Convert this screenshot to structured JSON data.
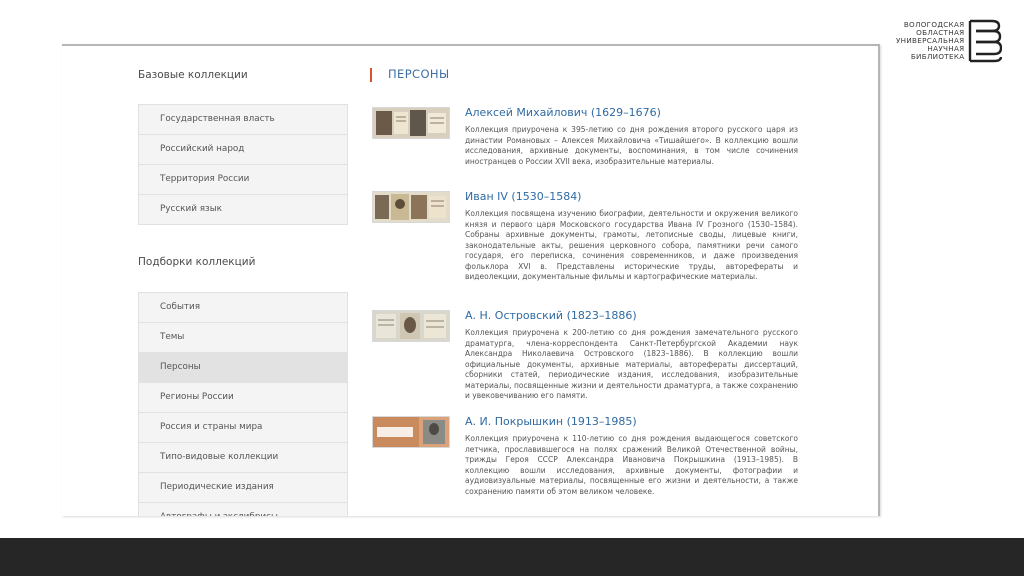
{
  "logo": {
    "lines": [
      "ВОЛОГОДСКАЯ",
      "ОБЛАСТНАЯ",
      "УНИВЕРСАЛЬНАЯ",
      "НАУЧНАЯ",
      "БИБЛИОТЕКА"
    ]
  },
  "sidebar": {
    "base_heading": "Базовые коллекции",
    "base_items": [
      "Государственная власть",
      "Российский народ",
      "Территория России",
      "Русский язык"
    ],
    "selection_heading": "Подборки коллекций",
    "selection_items": [
      "События",
      "Темы",
      "Персоны",
      "Регионы России",
      "Россия и страны мира",
      "Типо-видовые коллекции",
      "Периодические издания",
      "Автографы и экслибрисы"
    ],
    "active_item": "Персоны"
  },
  "main": {
    "section_title": "ПЕРСОНЫ",
    "entries": [
      {
        "title": "Алексей Михайлович (1629–1676)",
        "description": "Коллекция приурочена к 395-летию со дня рождения второго русского царя из династии Романовых – Алексея Михайловича «Тишайшего». В коллекцию вошли исследования, архивные документы, воспоминания, в том числе сочинения иностранцев о России XVII века, изобразительные материалы."
      },
      {
        "title": "Иван IV (1530–1584)",
        "description": "Коллекция посвящена изучению биографии, деятельности и окружения великого князя и первого царя Московского государства Ивана IV Грозного (1530–1584). Собраны архивные документы, грамоты, летописные своды, лицевые книги, законодательные акты, решения церковного собора, памятники речи самого государя, его переписка, сочинения современников, и даже произведения фольклора XVI в. Представлены исторические труды, авторефераты и видеолекции, документальные фильмы и картографические материалы."
      },
      {
        "title": "А. Н. Островский (1823–1886)",
        "description": "Коллекция приурочена к 200-летию со дня рождения замечательного русского драматурга, члена-корреспондента Санкт-Петербургской Академии наук Александра Николаевича Островского (1823–1886). В коллекцию вошли официальные документы, архивные материалы, авторефераты диссертаций, сборники статей, периодические издания, исследования, изобразительные материалы, посвященные жизни и деятельности драматурга, а также сохранению и увековечиванию его памяти."
      },
      {
        "title": "А. И. Покрышкин (1913–1985)",
        "description": "Коллекция приурочена к 110-летию со дня рождения выдающегося советского летчика, прославившегося на полях сражений Великой Отечественной войны, трижды Героя СССР Александра Ивановича Покрышкина (1913–1985). В коллекцию вошли исследования, архивные документы, фотографии и аудиовизуальные материалы, посвященные его жизни и деятельности, а также сохранению памяти об этом великом человеке."
      }
    ]
  },
  "colors": {
    "accent_red": "#d9532c",
    "link_blue": "#2f6aa3",
    "footer": "#262626"
  }
}
